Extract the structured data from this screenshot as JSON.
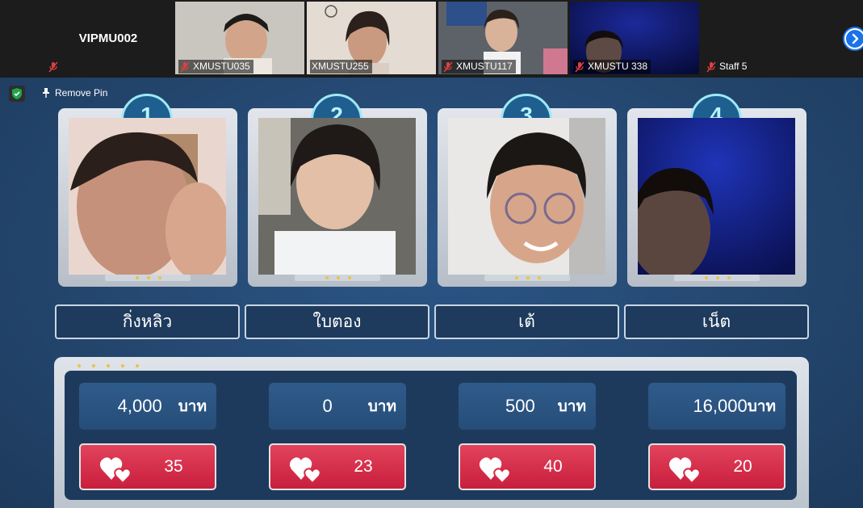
{
  "participants": [
    {
      "name": "VIPMU002",
      "type": "name-only"
    },
    {
      "name": "XMUSTU035",
      "type": "video"
    },
    {
      "name": "XMUSTU255",
      "type": "video"
    },
    {
      "name": "XMUSTU117",
      "type": "video"
    },
    {
      "name": "XMUSTU 338",
      "type": "video"
    },
    {
      "name": "Staff 5",
      "type": "name-only"
    }
  ],
  "meeting": {
    "remove_pin_label": "Remove Pin",
    "next_icon": "chevron-right-icon",
    "accent": "#1a73e8"
  },
  "players": [
    {
      "number": "1",
      "name": "กิ่งหลิว",
      "money": "4,000",
      "unit": "บาท",
      "hearts": "35"
    },
    {
      "number": "2",
      "name": "ใบตอง",
      "money": "0",
      "unit": "บาท",
      "hearts": "23"
    },
    {
      "number": "3",
      "name": "เต้",
      "money": "500",
      "unit": "บาท",
      "hearts": "40"
    },
    {
      "number": "4",
      "name": "เน็ต",
      "money": "16,000",
      "unit": "บาท",
      "hearts": "20"
    }
  ],
  "colors": {
    "stage": "#24476f",
    "heart_button": "#d42a47",
    "badge_glow": "#9ee8f6"
  }
}
